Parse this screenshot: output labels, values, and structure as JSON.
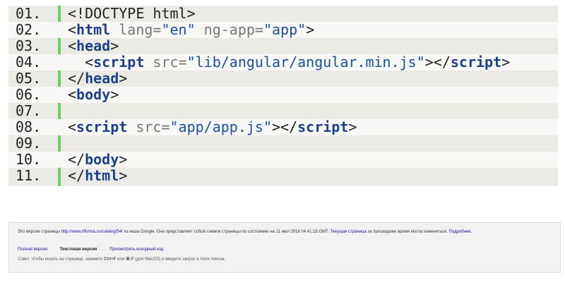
{
  "code": {
    "lines": [
      {
        "n": "01.",
        "parts": [
          [
            "plain",
            "<!DOCTYPE html>"
          ]
        ]
      },
      {
        "n": "02.",
        "parts": [
          [
            "plain",
            "<"
          ],
          [
            "tag",
            "html"
          ],
          [
            "attr",
            " lang="
          ],
          [
            "val",
            "\"en\""
          ],
          [
            "attr",
            " ng-app="
          ],
          [
            "val",
            "\"app\""
          ],
          [
            "plain",
            ">"
          ]
        ]
      },
      {
        "n": "03.",
        "parts": [
          [
            "plain",
            "<"
          ],
          [
            "tag",
            "head"
          ],
          [
            "plain",
            ">"
          ]
        ]
      },
      {
        "n": "04.",
        "parts": [
          [
            "plain",
            "  <"
          ],
          [
            "tag",
            "script"
          ],
          [
            "attr",
            " src="
          ],
          [
            "val",
            "\"lib/angular/angular.min.js\""
          ],
          [
            "plain",
            "></"
          ],
          [
            "tag",
            "script"
          ],
          [
            "plain",
            ">"
          ]
        ]
      },
      {
        "n": "05.",
        "parts": [
          [
            "plain",
            "</"
          ],
          [
            "tag",
            "head"
          ],
          [
            "plain",
            ">"
          ]
        ]
      },
      {
        "n": "06.",
        "parts": [
          [
            "plain",
            "<"
          ],
          [
            "tag",
            "body"
          ],
          [
            "plain",
            ">"
          ]
        ]
      },
      {
        "n": "07.",
        "parts": []
      },
      {
        "n": "08.",
        "parts": [
          [
            "plain",
            "<"
          ],
          [
            "tag",
            "script"
          ],
          [
            "attr",
            " src="
          ],
          [
            "val",
            "\"app/app.js\""
          ],
          [
            "plain",
            "></"
          ],
          [
            "tag",
            "script"
          ],
          [
            "plain",
            ">"
          ]
        ]
      },
      {
        "n": "09.",
        "parts": []
      },
      {
        "n": "10.",
        "parts": [
          [
            "plain",
            "</"
          ],
          [
            "tag",
            "body"
          ],
          [
            "plain",
            ">"
          ]
        ]
      },
      {
        "n": "11.",
        "parts": [
          [
            "plain",
            "</"
          ],
          [
            "tag",
            "html"
          ],
          [
            "plain",
            ">"
          ]
        ]
      }
    ]
  },
  "cache": {
    "prefix": "Это версия страницы ",
    "url": "http://www.rfforma.su/catalog/54/",
    "mid": " из кеша Google. Она представляет собой снимок страницы по состоянию на 11 июл 2018 04:41:15 GMT. ",
    "current_link": "Текущая страница",
    "after_current": " за прошедшее время могла измениться. ",
    "more_link": "Подробнее.",
    "full_version": "Полная версия",
    "text_version": "Текстовая версия",
    "view_source": "Просмотреть исходный код",
    "tip_a": "Совет. Чтобы искать на странице, нажмите ",
    "tip_key1": "Ctrl+F",
    "tip_b": " или ",
    "tip_key2": "⌘-F",
    "tip_c": " (для MacOS) и введите запрос в поле поиска."
  }
}
